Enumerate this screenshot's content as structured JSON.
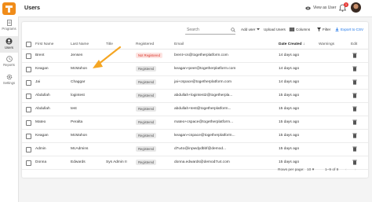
{
  "sidebar": {
    "items": [
      {
        "label": "Programs",
        "icon": "document-icon",
        "active": false
      },
      {
        "label": "Users",
        "icon": "user-circle-icon",
        "active": true
      },
      {
        "label": "Reports",
        "icon": "clock-icon",
        "active": false
      },
      {
        "label": "Settings",
        "icon": "gear-icon",
        "active": false
      }
    ]
  },
  "header": {
    "title": "Users",
    "view_as_label": "View as User",
    "notification_count": "1"
  },
  "toolbar": {
    "search_placeholder": "Search",
    "add_user_label": "Add user",
    "upload_users_label": "Upload Users",
    "columns_label": "Columns",
    "filter_label": "Filter",
    "export_label": "Export to CSV"
  },
  "table": {
    "columns": {
      "first_name": "First Name",
      "last_name": "Last Name",
      "title": "Title",
      "registered": "Registered",
      "email": "Email",
      "date_created": "Date Created",
      "warnings": "Warnings",
      "edit": "Edit"
    },
    "rows": [
      {
        "first": "Brent",
        "last": "Jensen",
        "title": "",
        "status": "Not Registered",
        "email": "brent+cs@togetherplatform.com",
        "date": "14 days ago"
      },
      {
        "first": "Keagan",
        "last": "McMahon",
        "title": "",
        "status": "Registered",
        "email": "keagan+peer@togetherplatform.com",
        "date": "14 days ago"
      },
      {
        "first": "Jai",
        "last": "Chaggar",
        "title": "",
        "status": "Registered",
        "email": "jai+cspace@togetherplatform.com",
        "date": "14 days ago"
      },
      {
        "first": "Abdullah",
        "last": "logintest",
        "title": "",
        "status": "Registered",
        "email": "abdullah+logintest2@togetherpla...",
        "date": "15 days ago"
      },
      {
        "first": "Abdullah",
        "last": "test",
        "title": "",
        "status": "Registered",
        "email": "abdullah+test@togetherplatform...",
        "date": "15 days ago"
      },
      {
        "first": "Mateo",
        "last": "Peralta",
        "title": "",
        "status": "Registered",
        "email": "mateo+cspace@togetherplatform...",
        "date": "15 days ago"
      },
      {
        "first": "Keagan",
        "last": "McMahon",
        "title": "",
        "status": "Registered",
        "email": "keagan+cspace@togetherplatform...",
        "date": "15 days ago"
      },
      {
        "first": "Admin",
        "last": "McAdmins",
        "title": "",
        "status": "Registered",
        "email": "d7u4o@inpwdydbbf@demod...",
        "date": "15 days ago"
      },
      {
        "first": "Donna",
        "last": "Edwards",
        "title": "Sys Admin II",
        "status": "Registered",
        "email": "donna.edwards@demod7u4.com",
        "date": "15 days ago"
      }
    ]
  },
  "footer": {
    "rows_per_page_label": "Rows per page:",
    "rows_per_page_value": "10",
    "range": "1–9 of 9"
  },
  "colors": {
    "accent": "#f08c1a",
    "link": "#1a73e8",
    "not_registered_bg": "#fde4e2",
    "not_registered_text": "#d93025",
    "annotation_arrow": "#f5a623"
  }
}
